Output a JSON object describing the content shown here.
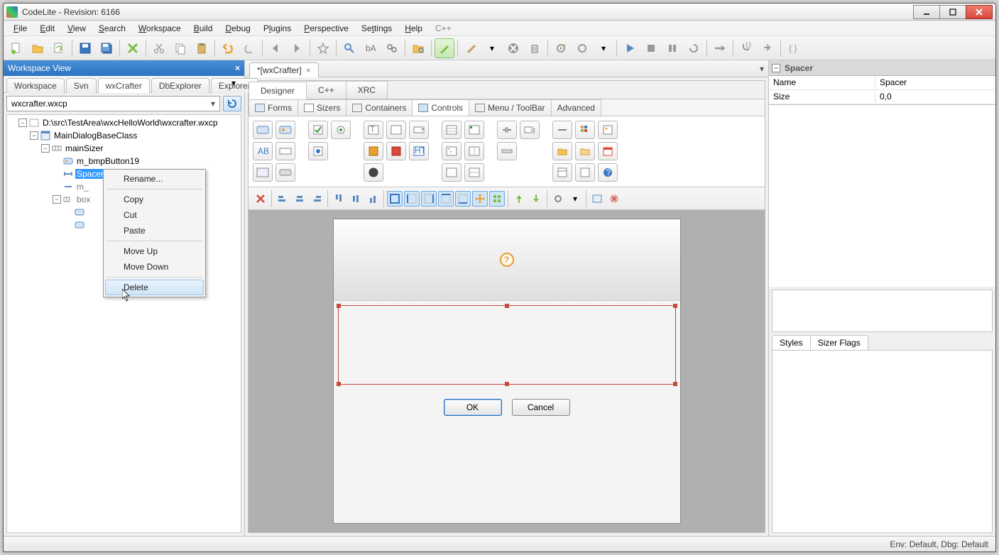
{
  "window": {
    "title": "CodeLite - Revision: 6166"
  },
  "menus": [
    "File",
    "Edit",
    "View",
    "Search",
    "Workspace",
    "Build",
    "Debug",
    "Plugins",
    "Perspective",
    "Settings",
    "Help",
    "C++"
  ],
  "workspace": {
    "header": "Workspace View",
    "tabs": [
      "Workspace",
      "Svn",
      "wxCrafter",
      "DbExplorer",
      "Explorer"
    ],
    "active_tab": "wxCrafter",
    "combo_value": "wxcrafter.wxcp",
    "tree": {
      "root": "D:\\src\\TestArea\\wxcHelloWorld\\wxcrafter.wxcp",
      "n1": "MainDialogBaseClass",
      "n2": "mainSizer",
      "n3": "m_bmpButton19",
      "n4": "Spacer",
      "n5": "m_",
      "n6": "box"
    }
  },
  "context_menu": {
    "rename": "Rename...",
    "copy": "Copy",
    "cut": "Cut",
    "paste": "Paste",
    "move_up": "Move Up",
    "move_down": "Move Down",
    "delete": "Delete"
  },
  "editor": {
    "doc_tab": "*[wxCrafter]",
    "designer_tabs": [
      "Designer",
      "C++",
      "XRC"
    ],
    "palette_tabs": [
      "Forms",
      "Sizers",
      "Containers",
      "Controls",
      "Menu / ToolBar",
      "Advanced"
    ],
    "active_palette": "Controls",
    "dialog_ok": "OK",
    "dialog_cancel": "Cancel"
  },
  "properties": {
    "header": "Spacer",
    "rows": [
      {
        "k": "Name",
        "v": "Spacer"
      },
      {
        "k": "Size",
        "v": "0,0"
      }
    ],
    "style_tabs": [
      "Styles",
      "Sizer Flags"
    ]
  },
  "status": "Env: Default, Dbg: Default"
}
